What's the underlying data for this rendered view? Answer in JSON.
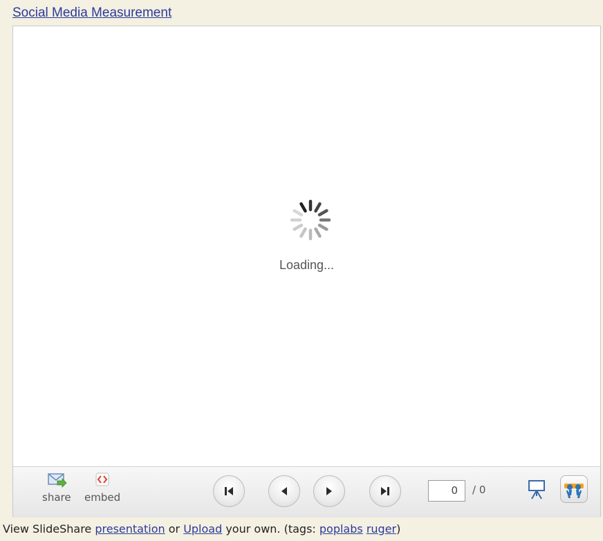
{
  "title": "Social Media Measurement",
  "loading_text": "Loading...",
  "toolbar": {
    "share_label": "share",
    "embed_label": "embed",
    "page_current": "0",
    "page_total": "/ 0"
  },
  "footer": {
    "prefix": "View SlideShare ",
    "presentation_link": "presentation",
    "or_text": " or ",
    "upload_link": "Upload",
    "suffix": " your own. (tags: ",
    "tag1": "poplabs",
    "space": " ",
    "tag2": "ruger",
    "close": ")"
  }
}
